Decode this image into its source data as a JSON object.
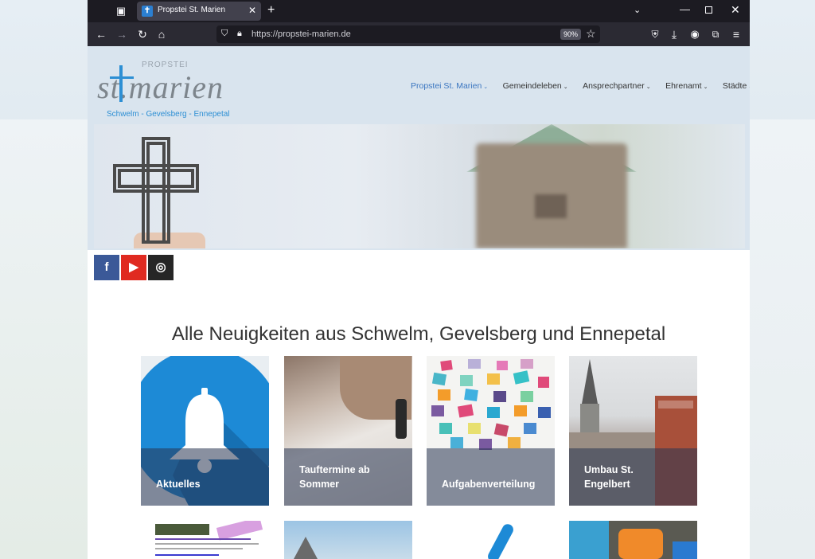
{
  "browser": {
    "tab_title": "Propstei St. Marien",
    "url": "https://propstei-marien.de",
    "zoom": "90%"
  },
  "site": {
    "logo_propstei": "PROPSTEI",
    "logo_main": "st.marien",
    "logo_sub": "Schwelm - Gevelsberg - Ennepetal"
  },
  "nav": {
    "items": [
      {
        "label": "Propstei St. Marien"
      },
      {
        "label": "Gemeindeleben"
      },
      {
        "label": "Ansprechpartner"
      },
      {
        "label": "Ehrenamt"
      },
      {
        "label": "Städte"
      }
    ]
  },
  "news": {
    "title": "Alle Neuigkeiten aus Schwelm, Gevelsberg und Ennepetal",
    "cards": [
      {
        "label": "Aktuelles"
      },
      {
        "label": "Tauftermine ab\nSommer"
      },
      {
        "label": "Aufgabenverteilung"
      },
      {
        "label": "Umbau St.\nEngelbert"
      }
    ]
  },
  "colors": {
    "accent": "#3b76c0",
    "facebook": "#3b5998",
    "youtube": "#e02a20",
    "instagram": "#262626"
  }
}
